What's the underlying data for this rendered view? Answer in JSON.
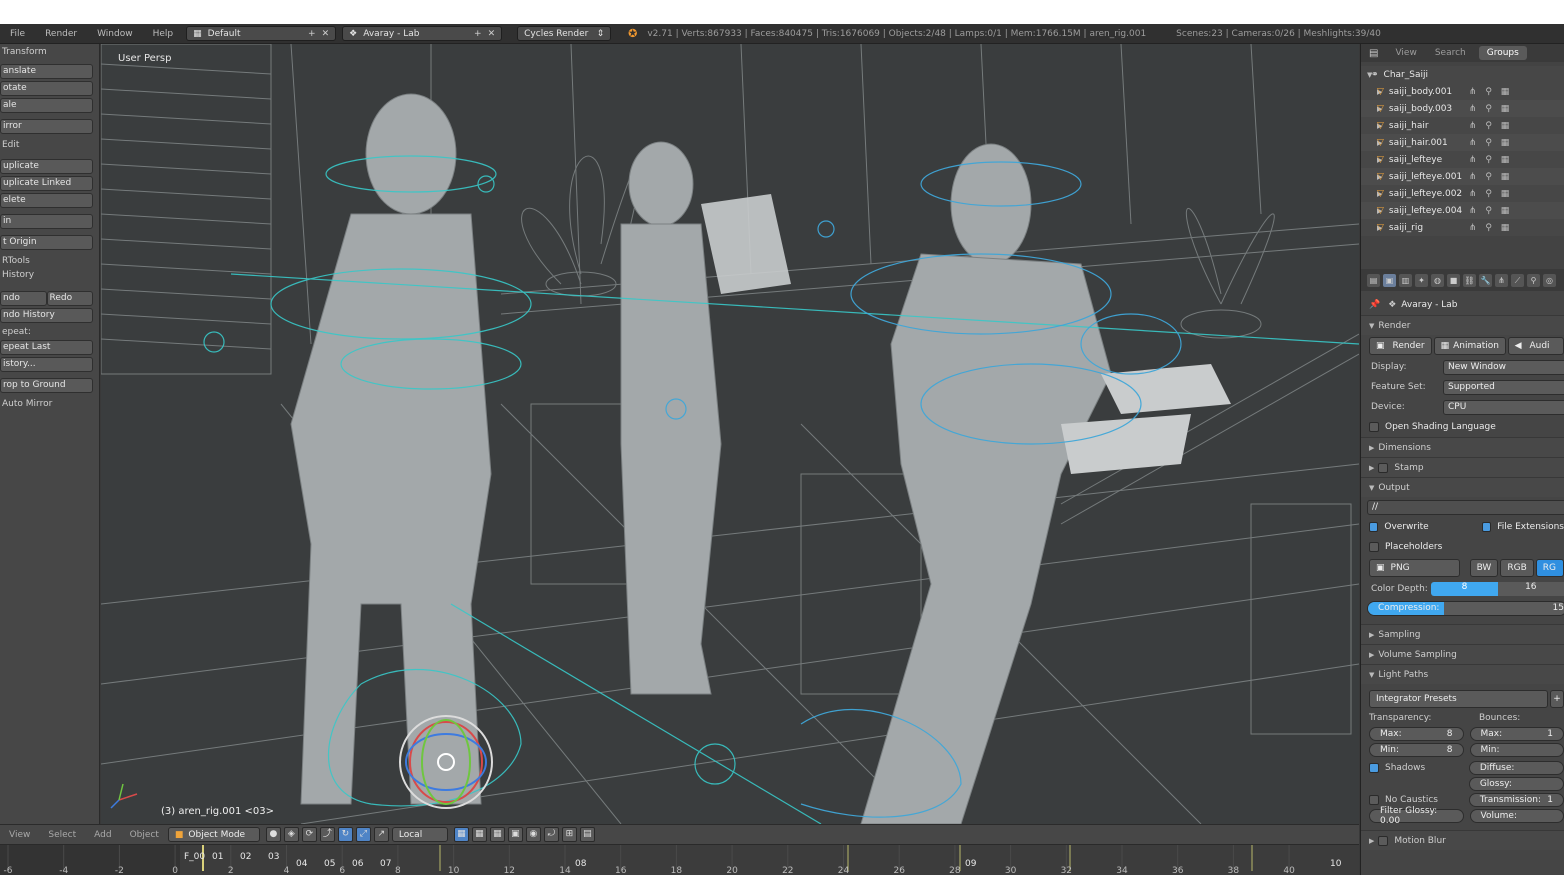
{
  "menu": {
    "file": "File",
    "render": "Render",
    "window": "Window",
    "help": "Help"
  },
  "header": {
    "screen_layout": "Default",
    "scene_name": "Avaray - Lab",
    "engine": "Cycles Render",
    "stats": "v2.71 | Verts:867933 | Faces:840475 | Tris:1676069 | Objects:2/48 | Lamps:0/1 | Mem:1766.15M | aren_rig.001",
    "stats2": "Scenes:23 | Cameras:0/26 | Meshlights:39/40"
  },
  "toolshelf": {
    "transform": "Transform",
    "translate": "anslate",
    "rotate": "otate",
    "scale": "ale",
    "mirror": "irror",
    "edit": "Edit",
    "duplicate": "uplicate",
    "duplicate_linked": "uplicate Linked",
    "delete": "elete",
    "join": "in",
    "set_origin": "t Origin",
    "rtools": "RTools",
    "history": "History",
    "undo": "ndo",
    "redo": "Redo",
    "undo_history": "ndo History",
    "repeat": "epeat:",
    "repeat_last": "epeat Last",
    "history2": "istory...",
    "drop_to_ground": "rop to Ground",
    "auto_mirror": "Auto Mirror"
  },
  "viewport": {
    "view_label": "User Persp",
    "object_label": "(3) aren_rig.001 <03>"
  },
  "view_header": {
    "view": "View",
    "select": "Select",
    "add": "Add",
    "object": "Object",
    "mode": "Object Mode",
    "orientation": "Local"
  },
  "timeline": {
    "ticks": [
      "-6",
      "-4",
      "-2",
      "0",
      "2",
      "4",
      "6",
      "8",
      "10",
      "12",
      "14",
      "16",
      "18",
      "20",
      "22",
      "24",
      "26",
      "28",
      "30",
      "32",
      "34",
      "36",
      "38",
      "40"
    ],
    "markers": [
      "F_00",
      "01",
      "02",
      "03",
      "04",
      "05",
      "06",
      "07",
      "08",
      "09",
      "10"
    ]
  },
  "outliner": {
    "tabs": [
      "View",
      "Search",
      "Groups"
    ],
    "root": "Char_Saiji",
    "items": [
      "saiji_body.001",
      "saiji_body.003",
      "saiji_hair",
      "saiji_hair.001",
      "saiji_lefteye",
      "saiji_lefteye.001",
      "saiji_lefteye.002",
      "saiji_lefteye.004",
      "saiji_rig"
    ]
  },
  "properties": {
    "scene": "Avaray - Lab",
    "render_panel": "Render",
    "render_btn": "Render",
    "animation_btn": "Animation",
    "audio_btn": "Audi",
    "display_label": "Display:",
    "display_value": "New Window",
    "feature_label": "Feature Set:",
    "feature_value": "Supported",
    "device_label": "Device:",
    "device_value": "CPU",
    "osl": "Open Shading Language",
    "dimensions": "Dimensions",
    "stamp": "Stamp",
    "output": "Output",
    "output_path": "//",
    "overwrite": "Overwrite",
    "file_ext": "File Extensions",
    "placeholders": "Placeholders",
    "format": "PNG",
    "bw": "BW",
    "rgb": "RGB",
    "rgba": "RG",
    "color_depth_label": "Color Depth:",
    "depth_8": "8",
    "depth_16": "16",
    "compression_label": "Compression:",
    "compression_value": "15",
    "sampling": "Sampling",
    "volume_sampling": "Volume Sampling",
    "light_paths": "Light Paths",
    "integrator": "Integrator Presets",
    "transparency": "Transparency:",
    "bounces": "Bounces:",
    "max": "Max:",
    "max_val": "8",
    "min": "Min:",
    "min_val": "8",
    "max_b": "Max:",
    "max_b_val": "1",
    "min_b": "Min:",
    "shadows": "Shadows",
    "no_caustics": "No Caustics",
    "filter_glossy": "Filter Glossy: 0.00",
    "diffuse": "Diffuse:",
    "glossy": "Glossy:",
    "transmission": "Transmission:",
    "transmission_val": "1",
    "volume": "Volume:",
    "motion_blur": "Motion Blur"
  }
}
